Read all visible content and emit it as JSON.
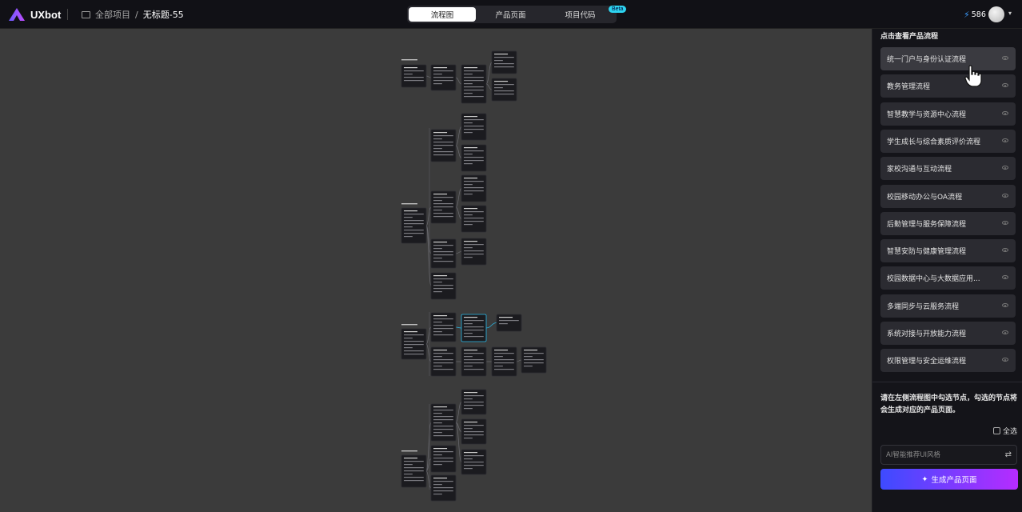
{
  "app": {
    "logo_text": "UXbot"
  },
  "breadcrumb": {
    "root": "全部项目",
    "separator": "/",
    "current": "无标题-55"
  },
  "tabs": [
    {
      "label": "流程图",
      "active": true
    },
    {
      "label": "产品页面",
      "active": false
    },
    {
      "label": "项目代码",
      "active": false
    }
  ],
  "beta_badge": "Beta",
  "credits": {
    "value": "586",
    "icon": "lightning-icon"
  },
  "panel": {
    "title": "点击查看产品流程",
    "flows": [
      "统一门户与身份认证流程",
      "教务管理流程",
      "智慧教学与资源中心流程",
      "学生成长与综合素质评价流程",
      "家校沟通与互动流程",
      "校园移动办公与OA流程",
      "后勤管理与服务保障流程",
      "智慧安防与健康管理流程",
      "校园数据中心与大数据应用...",
      "多端同步与云服务流程",
      "系统对接与开放能力流程",
      "权限管理与安全运维流程"
    ],
    "hint": "请在左侧流程图中勾选节点，勾选的节点将会生成对应的产品页面。",
    "select_all": "全选",
    "style_placeholder": "AI智能推荐UI风格",
    "generate_button": "生成产品页面"
  },
  "colors": {
    "accent_start": "#3d4bff",
    "accent_end": "#b62cff",
    "beta": "#2dd4f0",
    "node_bg": "#1b1b1f",
    "node_selected": "#2ab8e8"
  }
}
